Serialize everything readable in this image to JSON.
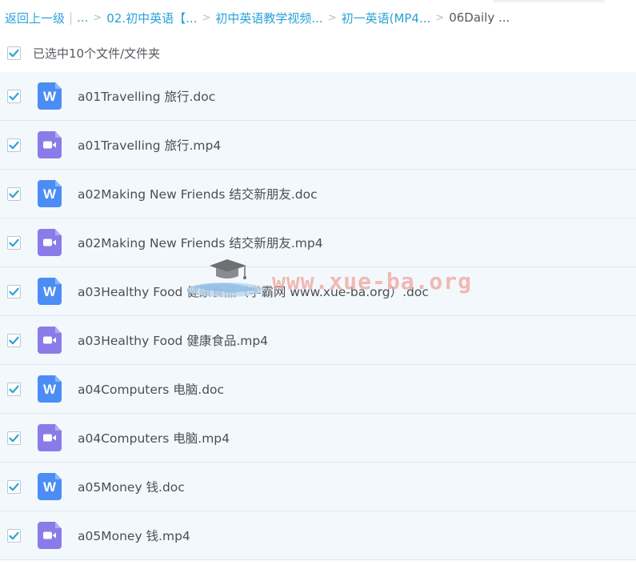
{
  "breadcrumb": {
    "back": "返回上一级",
    "divider": "|",
    "ellipsis": "...",
    "sep": ">",
    "items": [
      "02.初中英语【...",
      "初中英语教学视频...",
      "初一英语(MP4..."
    ],
    "current": "06Daily ..."
  },
  "selection": {
    "label": "已选中10个文件/文件夹",
    "checked": true
  },
  "files": [
    {
      "name": "a01Travelling 旅行.doc",
      "type": "doc",
      "icon": "word-doc-icon"
    },
    {
      "name": "a01Travelling 旅行.mp4",
      "type": "mp4",
      "icon": "video-file-icon"
    },
    {
      "name": "a02Making New Friends 结交新朋友.doc",
      "type": "doc",
      "icon": "word-doc-icon"
    },
    {
      "name": "a02Making New Friends 结交新朋友.mp4",
      "type": "mp4",
      "icon": "video-file-icon"
    },
    {
      "name": "a03Healthy Food 健康食品（学霸网 www.xue-ba.org）.doc",
      "type": "doc",
      "icon": "word-doc-icon"
    },
    {
      "name": "a03Healthy Food 健康食品.mp4",
      "type": "mp4",
      "icon": "video-file-icon"
    },
    {
      "name": "a04Computers 电脑.doc",
      "type": "doc",
      "icon": "word-doc-icon"
    },
    {
      "name": "a04Computers 电脑.mp4",
      "type": "mp4",
      "icon": "video-file-icon"
    },
    {
      "name": "a05Money 钱.doc",
      "type": "doc",
      "icon": "word-doc-icon"
    },
    {
      "name": "a05Money 钱.mp4",
      "type": "mp4",
      "icon": "video-file-icon"
    }
  ],
  "doc_icon_letter": "W",
  "watermark": {
    "text": "www.xue-ba.org"
  },
  "colors": {
    "accent": "#2aa2d8",
    "row_bg": "#f3f8fc",
    "doc_icon": "#4c8df5",
    "video_icon": "#8b7be9",
    "watermark": "#f0a49a"
  }
}
